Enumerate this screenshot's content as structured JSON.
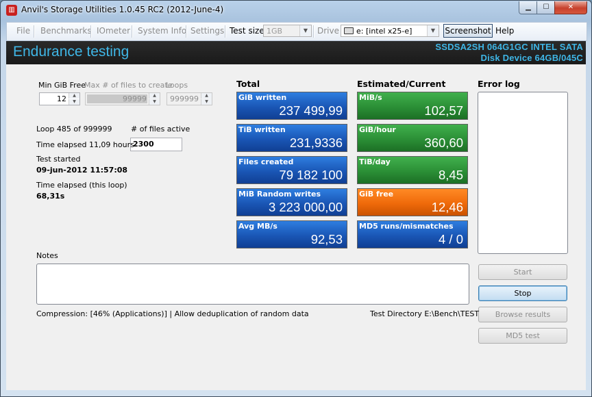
{
  "window": {
    "title": "Anvil's Storage Utilities 1.0.45 RC2 (2012-June-4)",
    "minimize_glyph": "▁",
    "maximize_glyph": "☐",
    "close_glyph": "✕",
    "app_icon_glyph": "▥"
  },
  "menubar": {
    "file": "File",
    "benchmarks": "Benchmarks",
    "iometer": "IOmeter",
    "system_info": "System Info",
    "settings": "Settings",
    "test_size_label": "Test size",
    "test_size_value": "1GB",
    "drive_label": "Drive",
    "drive_value": "e: [intel x25-e]",
    "screenshot": "Screenshot",
    "help": "Help",
    "dropdown_glyph": "▼"
  },
  "header": {
    "title": "Endurance testing",
    "device_line1": "SSDSA2SH 064G1GC INTEL SATA",
    "device_line2": "Disk Device 64GB/045C"
  },
  "settings": {
    "min_gib_free_label": "Min GiB Free",
    "min_gib_free_value": "12",
    "max_files_label": "Max # of files to create",
    "max_files_value": "99999",
    "loops_label": "Loops",
    "loops_value": "999999",
    "spin_up_glyph": "▲",
    "spin_down_glyph": "▼"
  },
  "status": {
    "loop": "Loop 485 of 999999",
    "files_active_label": "# of files active",
    "files_active_value": "2300",
    "time_elapsed": "Time elapsed 11,09 hours",
    "test_started_label": "Test started",
    "test_started_value": "09-jun-2012 11:57:08",
    "time_loop_label": "Time elapsed (this loop)",
    "time_loop_value": "68,31s"
  },
  "total": {
    "heading": "Total",
    "tiles": [
      {
        "label": "GiB written",
        "value": "237 499,99"
      },
      {
        "label": "TiB written",
        "value": "231,9336"
      },
      {
        "label": "Files created",
        "value": "79 182 100"
      },
      {
        "label": "MiB Random writes",
        "value": "3 223 000,00"
      },
      {
        "label": "Avg MB/s",
        "value": "92,53"
      }
    ]
  },
  "estimated": {
    "heading": "Estimated/Current",
    "tiles": [
      {
        "label": "MiB/s",
        "value": "102,57"
      },
      {
        "label": "GiB/hour",
        "value": "360,60"
      },
      {
        "label": "TiB/day",
        "value": "8,45"
      },
      {
        "label": "GiB free",
        "value": "12,46"
      },
      {
        "label": "MD5 runs/mismatches",
        "value": "4 / 0"
      }
    ]
  },
  "error_log": {
    "heading": "Error log"
  },
  "notes": {
    "label": "Notes"
  },
  "footer": {
    "compression": "Compression: [46% (Applications)] | Allow deduplication of random data",
    "test_directory": "Test Directory E:\\Bench\\TEST"
  },
  "actions": {
    "start": "Start",
    "stop": "Stop",
    "browse": "Browse results",
    "md5": "MD5 test"
  },
  "colors": {
    "header_text": "#3fb6e6",
    "tile_blue": "#1a56b5",
    "tile_green": "#2b8f36",
    "tile_orange": "#ef6a0a"
  }
}
